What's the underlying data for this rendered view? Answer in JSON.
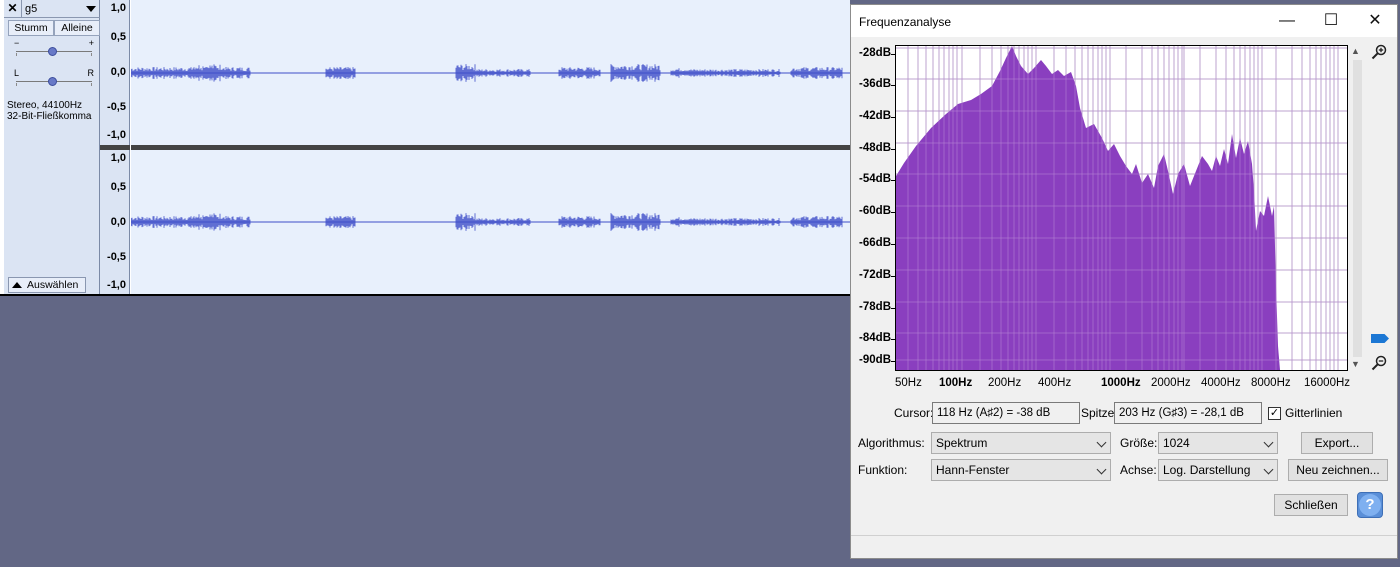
{
  "track": {
    "close_glyph": "✕",
    "name": "g5",
    "mute_label": "Stumm",
    "solo_label": "Alleine",
    "gain_minus": "−",
    "gain_plus": "+",
    "pan_left": "L",
    "pan_right": "R",
    "info_line1": "Stereo, 44100Hz",
    "info_line2": "32-Bit-Fließkomma",
    "select_label": "Auswählen",
    "ruler_labels": [
      "1,0",
      "0,5",
      "0,0",
      "-0,5",
      "-1,0"
    ],
    "waveform_color": "#3e4ec8",
    "background_color": "#e8f0fc"
  },
  "dialog": {
    "title": "Frequenzanalyse",
    "window_buttons": {
      "minimize": "—",
      "maximize": "☐",
      "close": "✕"
    },
    "db_labels": [
      "-28dB",
      "-36dB",
      "-42dB",
      "-48dB",
      "-54dB",
      "-60dB",
      "-66dB",
      "-72dB",
      "-78dB",
      "-84dB",
      "-90dB"
    ],
    "hz_labels": [
      {
        "text": "50Hz",
        "bold": false
      },
      {
        "text": "100Hz",
        "bold": true
      },
      {
        "text": "200Hz",
        "bold": false
      },
      {
        "text": "400Hz",
        "bold": false
      },
      {
        "text": "1000Hz",
        "bold": true
      },
      {
        "text": "2000Hz",
        "bold": false
      },
      {
        "text": "4000Hz",
        "bold": false
      },
      {
        "text": "8000Hz",
        "bold": false
      },
      {
        "text": "16000Hz",
        "bold": false
      }
    ],
    "spectrum_color": "#8a3fbf",
    "cursor_label": "Cursor:",
    "cursor_value": "118 Hz (A♯2) = -38 dB",
    "peak_label": "Spitze:",
    "peak_value": "203 Hz (G♯3) = -28,1 dB",
    "gridlines_label": "Gitterlinien",
    "gridlines_checked": true,
    "algorithm_label": "Algorithmus:",
    "algorithm_value": "Spektrum",
    "size_label": "Größe:",
    "size_value": "1024",
    "export_label": "Export...",
    "function_label": "Funktion:",
    "function_value": "Hann-Fenster",
    "axis_label": "Achse:",
    "axis_value": "Log. Darstellung",
    "replot_label": "Neu zeichnen...",
    "close_label": "Schließen",
    "help_label": "?"
  }
}
